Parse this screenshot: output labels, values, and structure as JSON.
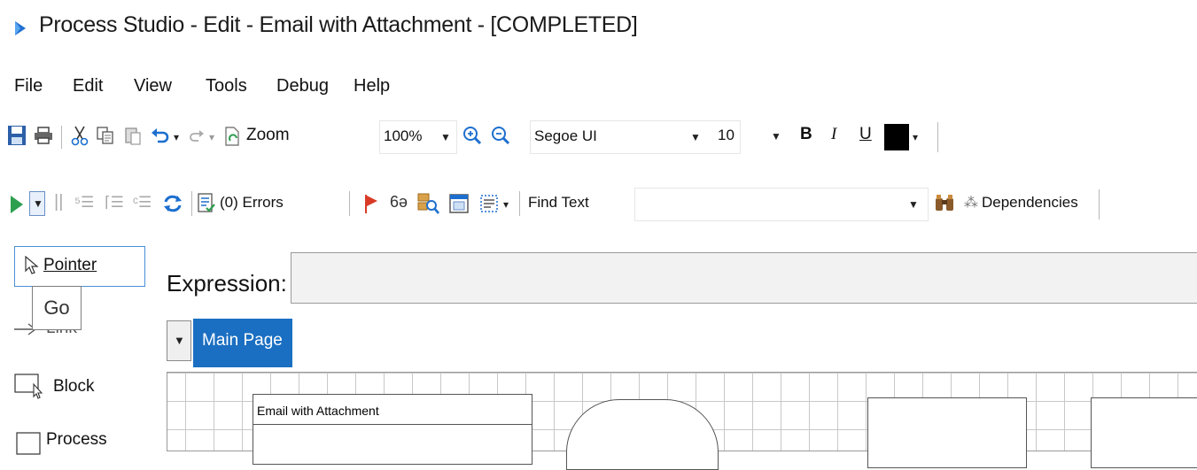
{
  "window": {
    "title": "Process Studio  - Edit - Email with Attachment - [COMPLETED]"
  },
  "menu": {
    "items": [
      "File",
      "Edit",
      "View",
      "Tools",
      "Debug",
      "Help"
    ]
  },
  "toolbar1": {
    "zoom_label": "Zoom",
    "zoom_value": "100%",
    "font_name": "Segoe UI",
    "font_size": "10",
    "bold_label": "B",
    "italic_label": "I",
    "underline_label": "U",
    "text_color": "#000000"
  },
  "toolbar2": {
    "errors_label": "(0) Errors",
    "find_text_label": "Find Text",
    "find_text_value": "",
    "dependencies_label": "Dependencies"
  },
  "palette": {
    "items": [
      "Pointer",
      "Link",
      "Block",
      "Process"
    ]
  },
  "tooltip": {
    "text": "Go"
  },
  "expression": {
    "label": "Expression:",
    "value": ""
  },
  "tabs": {
    "items": [
      "Main Page"
    ]
  },
  "canvas": {
    "block_title": "Email with Attachment"
  },
  "colors": {
    "accent": "#1a6fc2",
    "play_green": "#2e9e4f",
    "save_blue": "#2b5fa8",
    "flag_red": "#d93a26",
    "grid": "#c8c8c8"
  }
}
